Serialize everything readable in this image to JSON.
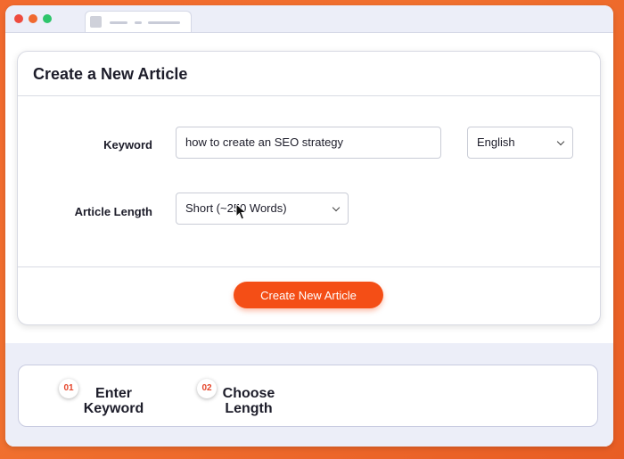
{
  "colors": {
    "accent": "#f44e16",
    "background": "#f26a2e",
    "browser_chrome": "#eceef8"
  },
  "window": {
    "controls": [
      "close",
      "minimize",
      "maximize"
    ]
  },
  "form": {
    "title": "Create a New Article",
    "keyword_label": "Keyword",
    "keyword_value": "how to create an SEO strategy",
    "language_value": "English",
    "length_label": "Article Length",
    "length_value": "Short (~250 Words)",
    "submit_label": "Create New Article"
  },
  "steps": [
    {
      "number": "01",
      "line1": "Enter",
      "line2": "Keyword"
    },
    {
      "number": "02",
      "line1": "Choose",
      "line2": "Length"
    }
  ]
}
